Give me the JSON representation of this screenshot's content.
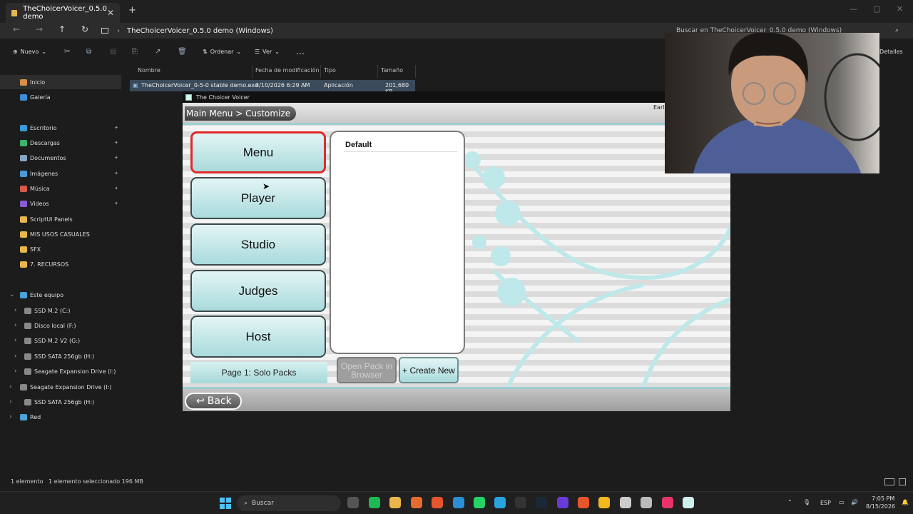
{
  "explorer": {
    "tab_title": "TheChoicerVoicer_0.5.0 demo",
    "address": "TheChoicerVoicer_0.5.0 demo (Windows)",
    "search_placeholder": "Buscar en TheChoicerVoicer_0.5.0 demo (Windows)",
    "toolbar": {
      "new": "Nuevo",
      "sort": "Ordenar",
      "view": "Ver",
      "details": "Detalles"
    },
    "sidebar": [
      {
        "label": "Inicio",
        "color": "#d98f4a"
      },
      {
        "label": "Galería",
        "color": "#3b8fd9"
      },
      {
        "label": "Escritorio",
        "color": "#3b9ad9"
      },
      {
        "label": "Descargas",
        "color": "#3bb56a"
      },
      {
        "label": "Documentos",
        "color": "#8aa4c4"
      },
      {
        "label": "Imágenes",
        "color": "#4a9ad9"
      },
      {
        "label": "Música",
        "color": "#d95a4a"
      },
      {
        "label": "Videos",
        "color": "#8a5ad9"
      },
      {
        "label": "ScriptUI Panels",
        "color": "#e8b64c"
      },
      {
        "label": "MIS USOS CASUALES",
        "color": "#e8b64c"
      },
      {
        "label": "SFX",
        "color": "#e8b64c"
      },
      {
        "label": "7. RECURSOS",
        "color": "#e8b64c"
      },
      {
        "label": "Este equipo",
        "color": "#4aa3d9"
      },
      {
        "label": "SSD M.2 (C:)",
        "color": "#888"
      },
      {
        "label": "Disco local (F:)",
        "color": "#888"
      },
      {
        "label": "SSD M.2 V2 (G:)",
        "color": "#888"
      },
      {
        "label": "SSD SATA 256gb (H:)",
        "color": "#888"
      },
      {
        "label": "Seagate Expansion Drive (I:)",
        "color": "#888"
      },
      {
        "label": "Seagate Expansion Drive (I:)",
        "color": "#888"
      },
      {
        "label": "SSD SATA 256gb (H:)",
        "color": "#888"
      },
      {
        "label": "Red",
        "color": "#4aa3d9"
      }
    ],
    "columns": {
      "name": "Nombre",
      "modified": "Fecha de modificación",
      "type": "Tipo",
      "size": "Tamaño"
    },
    "file": {
      "name": "TheChoicerVoicer_0-5-0 stable demo.exe",
      "modified": "3/10/2026 6:29 AM",
      "type": "Aplicación",
      "size": "201,680 KB"
    },
    "status": {
      "count": "1 elemento",
      "selected": "1 elemento seleccionado  196 MB"
    }
  },
  "game": {
    "window_title": "The Choicer Voicer",
    "breadcrumb": "Main Menu > Customize",
    "corner_text": "Earl",
    "menu_buttons": [
      "Menu",
      "Player",
      "Studio",
      "Judges",
      "Host"
    ],
    "page_label": "Page 1: Solo Packs",
    "pack_list_header": "Default",
    "open_pack": "Open Pack in Browser",
    "create_new": "+ Create New",
    "back": "Back"
  },
  "taskbar": {
    "search": "Buscar",
    "lang": "ESP",
    "time": "7:05 PM",
    "date": "8/15/2026"
  }
}
